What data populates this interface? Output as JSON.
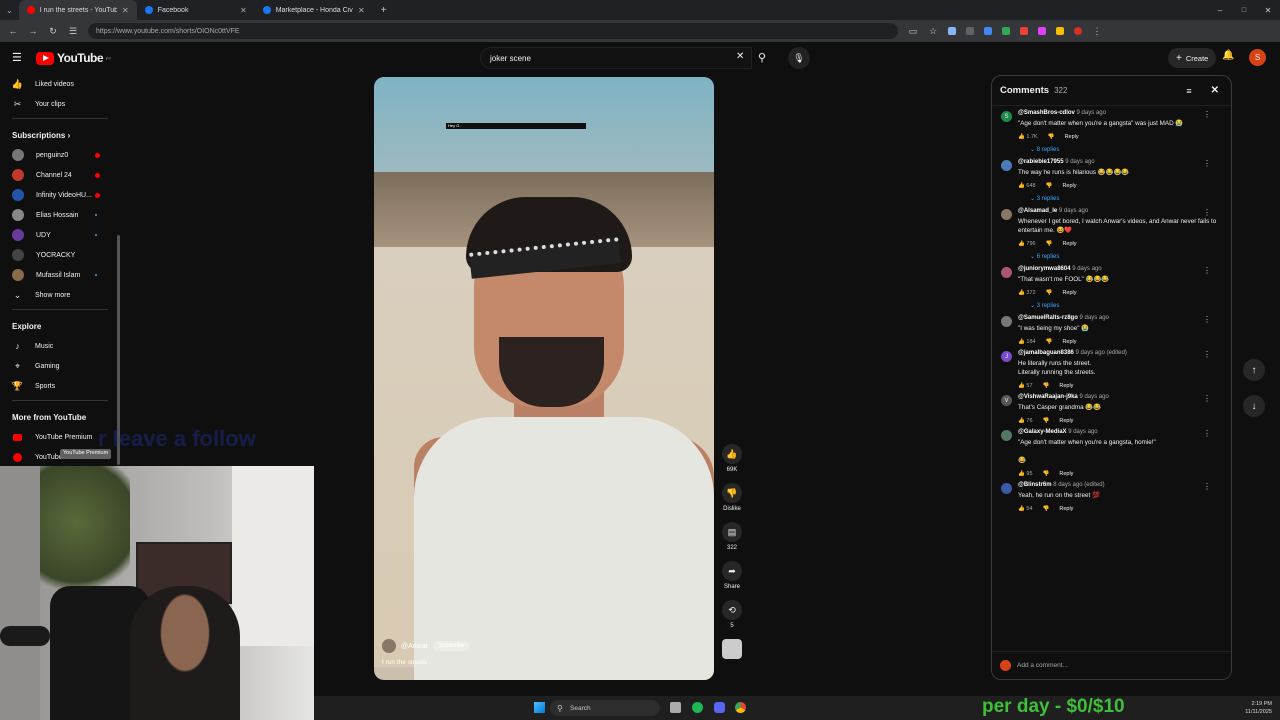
{
  "browser": {
    "tabs": [
      {
        "label": "I run the streets - YouTube",
        "color": "#ff0000",
        "active": true
      },
      {
        "label": "Facebook",
        "color": "#1877f2",
        "active": false
      },
      {
        "label": "Marketplace - Honda Civic For",
        "color": "#1877f2",
        "active": false
      }
    ],
    "url": "https://www.youtube.com/shorts/OIONc0ttVFE"
  },
  "youtube": {
    "logo_text": "YouTube",
    "logo_badge": "PT",
    "search_value": "joker scene",
    "create_label": "Create",
    "avatar_letter": "S"
  },
  "sidebar": {
    "top_items": [
      {
        "label": "Liked videos",
        "icon": "thumbs-up-icon"
      },
      {
        "label": "Your clips",
        "icon": "scissors-icon"
      }
    ],
    "subscriptions_header": "Subscriptions",
    "subscriptions": [
      {
        "label": "penguinz0",
        "indicator": "live",
        "color": "#777"
      },
      {
        "label": "Channel 24",
        "indicator": "live",
        "color": "#c0392b"
      },
      {
        "label": "Infinity VideoHU...",
        "indicator": "live",
        "color": "#2255aa"
      },
      {
        "label": "Elias Hossain",
        "indicator": "dot",
        "color": "#888"
      },
      {
        "label": "UDY",
        "indicator": "dot",
        "color": "#6a3a9a"
      },
      {
        "label": "YOCRACKY",
        "indicator": "none",
        "color": "#444"
      },
      {
        "label": "Mufassil Islam",
        "indicator": "dot",
        "color": "#8a6a4a"
      }
    ],
    "show_more": "Show more",
    "explore_header": "Explore",
    "explore": [
      {
        "label": "Music",
        "icon": "music-icon"
      },
      {
        "label": "Gaming",
        "icon": "gamepad-icon"
      },
      {
        "label": "Sports",
        "icon": "trophy-icon"
      }
    ],
    "more_header": "More from YouTube",
    "more": [
      {
        "label": "YouTube Premium",
        "color": "#ff0000"
      },
      {
        "label": "YouTube",
        "color": "#ff0000"
      }
    ],
    "tooltip": "YouTube Premium"
  },
  "overlay_text": "r leave a follow",
  "short": {
    "caption": "Hey G.",
    "channel": "@Anwar",
    "subscribe": "Subscribe",
    "title": "I run the streets",
    "likes": "69K",
    "dislike_label": "Dislike",
    "comments_count": "322",
    "share_label": "Share",
    "remix_count": "5"
  },
  "comments": {
    "title": "Comments",
    "count": "322",
    "add_placeholder": "Add a comment...",
    "items": [
      {
        "author": "@SmashBros-cdlov",
        "ago": "9 days ago",
        "text": "\"Age don't matter when you're a gangsta\" was just MAD 😭",
        "likes": "1.7K",
        "replies": "8 replies",
        "color": "#1a8a4a",
        "letter": "S"
      },
      {
        "author": "@rabiebie17955",
        "ago": "9 days ago",
        "text": "The way he runs is hilarious 😂😂😂😂",
        "likes": "648",
        "replies": "3 replies",
        "color": "#4a7ab8",
        "letter": ""
      },
      {
        "author": "@Alsamad_le",
        "ago": "9 days ago",
        "text": "Whenever I get bored, I watch Anwar's videos, and Anwar never fails to entertain me. 😆❤️",
        "likes": "796",
        "replies": "6 replies",
        "color": "#887766",
        "letter": ""
      },
      {
        "author": "@juniorymwa8604",
        "ago": "9 days ago",
        "text": "\"That wasn't me FOOL\" 😂😂😂",
        "likes": "372",
        "replies": "3 replies",
        "color": "#aa5577",
        "letter": ""
      },
      {
        "author": "@SamuelRalts-rz8go",
        "ago": "9 days ago",
        "text": "\"I was tieing my shoe\" 😭",
        "likes": "184",
        "replies": "",
        "color": "#777",
        "letter": ""
      },
      {
        "author": "@jamalbaguan8386",
        "ago": "9 days ago (edited)",
        "text": "He literally runs the street.\nLiterally running the streets.",
        "likes": "57",
        "replies": "",
        "color": "#7a4ac8",
        "letter": "J"
      },
      {
        "author": "@VishwaRaajan-j9ka",
        "ago": "9 days ago",
        "text": "That's Casper grandma 😂😂",
        "likes": "76",
        "replies": "",
        "color": "#555",
        "letter": "V"
      },
      {
        "author": "@Galaxy-MediaX",
        "ago": "9 days ago",
        "text": "\"Age don't matter when you're a gangsta, homie!\"\n\n😂",
        "likes": "95",
        "replies": "",
        "color": "#557766",
        "letter": ""
      },
      {
        "author": "@Blinstr6m",
        "ago": "8 days ago (edited)",
        "text": "Yeah, he run on the street 💯",
        "likes": "54",
        "replies": "",
        "color": "#3a5aa8",
        "letter": ""
      }
    ],
    "reply_label": "Reply"
  },
  "taskbar": {
    "search": "Search",
    "time": "2:19 PM",
    "date": "11/11/2025"
  },
  "pay_text": "per day - $0/$10"
}
